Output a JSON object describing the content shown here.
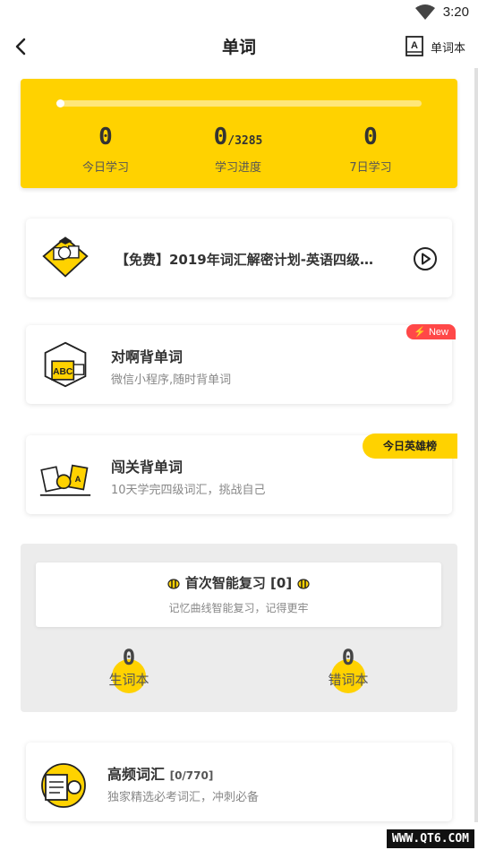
{
  "status_bar": {
    "time": "3:20"
  },
  "nav": {
    "title": "单词",
    "wordbook_label": "单词本"
  },
  "progress": {
    "percent": 0,
    "today": {
      "value": "0",
      "label": "今日学习"
    },
    "overall": {
      "value": "0",
      "total": "/3285",
      "label": "学习进度"
    },
    "week": {
      "value": "0",
      "label": "7日学习"
    }
  },
  "plan_card": {
    "title": "【免费】2019年词汇解密计划-英语四级…"
  },
  "duia_card": {
    "title": "对啊背单词",
    "subtitle": "微信小程序,随时背单词",
    "badge": "New"
  },
  "level_card": {
    "title": "闯关背单词",
    "subtitle": "10天学完四级词汇，挑战自己",
    "badge": "今日英雄榜"
  },
  "review": {
    "title": "首次智能复习 [0]",
    "subtitle": "记忆曲线智能复习，记得更牢",
    "new_words": {
      "value": "0",
      "label": "生词本"
    },
    "wrong_words": {
      "value": "0",
      "label": "错词本"
    }
  },
  "high_freq": {
    "title": "高频词汇",
    "count": "[0/770]",
    "subtitle": "独家精选必考词汇，冲刺必备"
  },
  "watermark": "WWW.QT6.COM",
  "colors": {
    "accent": "#ffd200",
    "badge_red": "#ff4848"
  }
}
